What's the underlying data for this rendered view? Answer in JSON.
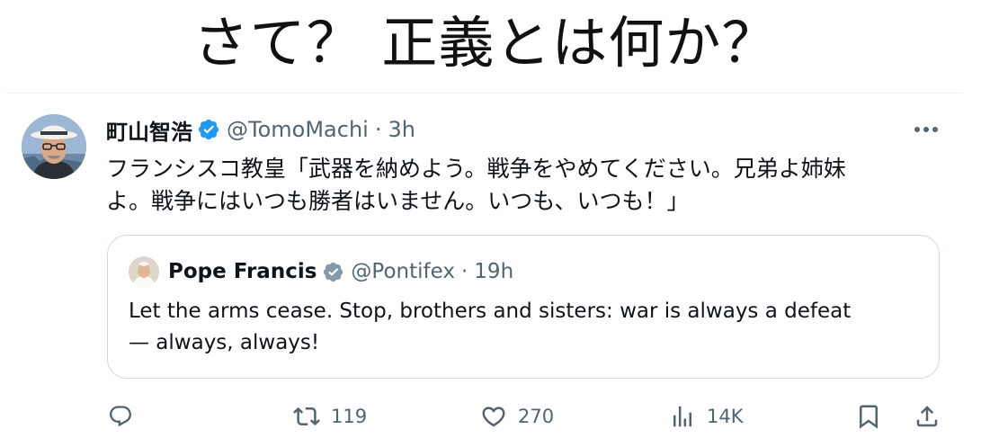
{
  "headline": "さて？ 正義とは何か？",
  "tweet": {
    "author_name": "町山智浩",
    "handle": "@TomoMachi",
    "separator": "·",
    "time": "3h",
    "text_line1": "フランシスコ教皇「武器を納めよう。戦争をやめてください。兄弟よ姉妹",
    "text_line2": "よ。戦争にはいつも勝者はいません。いつも、いつも！」"
  },
  "quote": {
    "author_name": "Pope Francis",
    "handle": "@Pontifex",
    "separator": "·",
    "time": "19h",
    "text_line1": "Let the arms cease. Stop, brothers and sisters: war is always a defeat",
    "text_line2": "— always, always!"
  },
  "actions": {
    "reply_count": "",
    "retweet_count": "119",
    "like_count": "270",
    "views_count": "14K"
  },
  "icons": {
    "verified": "verified-badge-icon",
    "quote_verified": "verified-badge-icon",
    "more": "more-horizontal-icon",
    "reply": "reply-bubble-icon",
    "retweet": "retweet-icon",
    "like": "heart-icon",
    "views": "bar-chart-icon",
    "bookmark": "bookmark-icon",
    "share": "share-upload-icon"
  },
  "colors": {
    "primary_text": "#0f1419",
    "secondary_text": "#536471",
    "verified_blue": "#1d9bf0",
    "verified_gray": "#829aab",
    "border": "#cfd9de"
  }
}
